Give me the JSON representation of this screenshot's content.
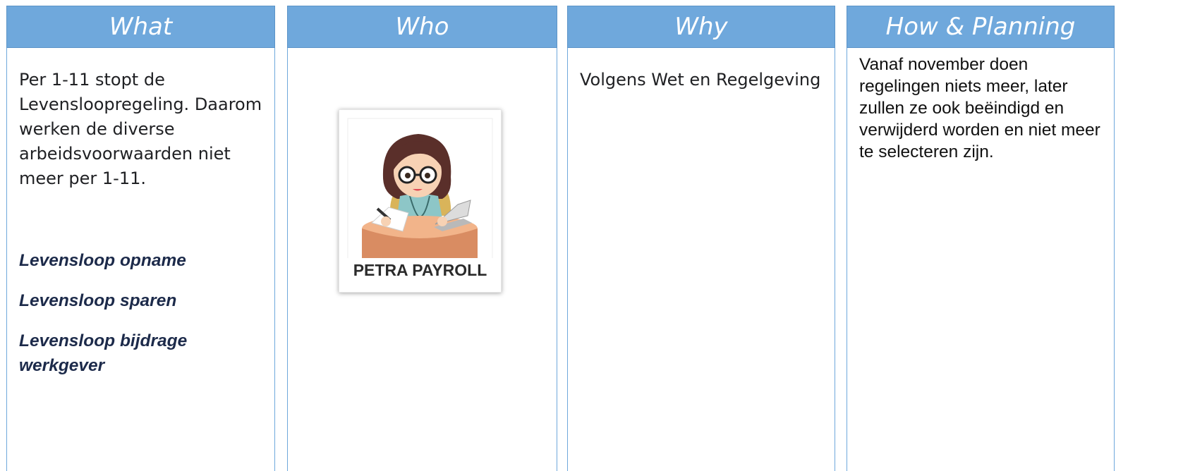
{
  "columns": {
    "what": {
      "header": "What",
      "body": "Per 1-11 stopt de Levensloopregeling. Daarom werken de diverse arbeidsvoorwaarden niet meer per 1-11.",
      "items": [
        "Levensloop opname",
        "Levensloop sparen",
        "Levensloop bijdrage werkgever"
      ]
    },
    "who": {
      "header": "Who",
      "logo_text": "PETRA PAYROLL"
    },
    "why": {
      "header": "Why",
      "body": "Volgens Wet en Regelgeving"
    },
    "how": {
      "header": "How & Planning",
      "body": "Vanaf november doen regelingen niets meer, later zullen ze ook beëindigd en verwijderd worden en niet meer te selecteren zijn."
    }
  },
  "colors": {
    "header_bg": "#6fa8dc",
    "item_text": "#1c2a4a"
  }
}
